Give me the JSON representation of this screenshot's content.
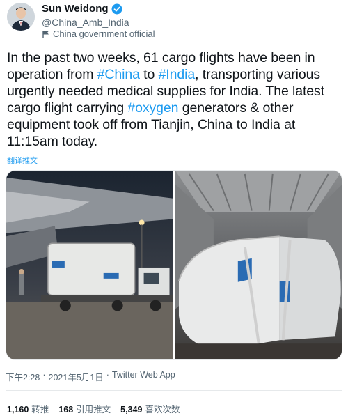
{
  "author": {
    "display_name": "Sun Weidong",
    "handle": "@China_Amb_India",
    "label": "China government official"
  },
  "tweet": {
    "segments": [
      {
        "text": "In the past two weeks, 61 cargo flights have been in operation from ",
        "tag": false
      },
      {
        "text": "#China",
        "tag": true
      },
      {
        "text": " to ",
        "tag": false
      },
      {
        "text": "#India",
        "tag": true
      },
      {
        "text": ", transporting various urgently needed medical supplies for India. The latest cargo flight carrying ",
        "tag": false
      },
      {
        "text": "#oxygen",
        "tag": true
      },
      {
        "text": " generators & other equipment took off from Tianjin, China to India at 11:15am today.",
        "tag": false
      }
    ],
    "translate_label": "翻译推文"
  },
  "meta": {
    "time": "下午2:28",
    "separator": "·",
    "date": "2021年5月1日",
    "source": "Twitter Web App"
  },
  "stats": {
    "retweets_count": "1,160",
    "retweets_label": "转推",
    "quotes_count": "168",
    "quotes_label": "引用推文",
    "likes_count": "5,349",
    "likes_label": "喜欢次数"
  },
  "colors": {
    "link": "#1d9bf0",
    "verified": "#1d9bf0",
    "text": "#0f1419",
    "muted": "#536471"
  },
  "icons": {
    "verified": "verified-badge-icon",
    "government": "flag-icon"
  }
}
